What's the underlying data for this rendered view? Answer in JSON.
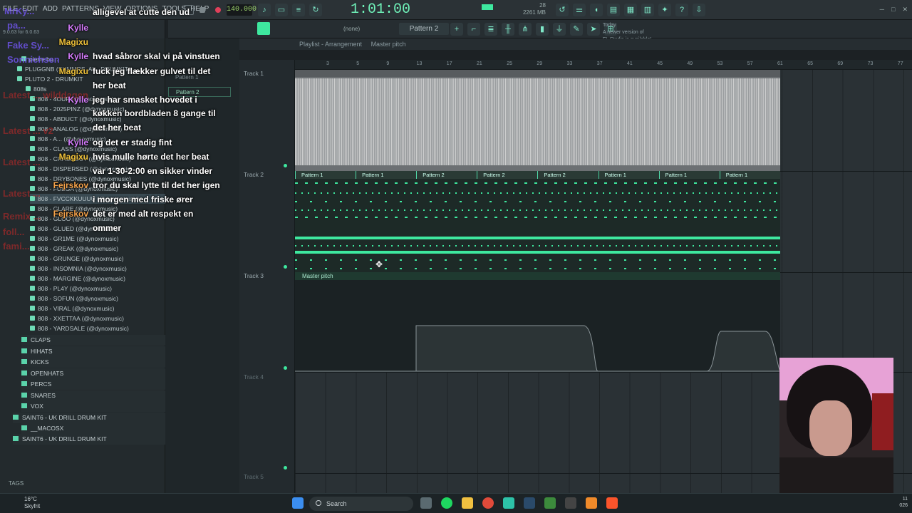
{
  "menu": [
    "FILE",
    "EDIT",
    "ADD",
    "PATTERNS",
    "VIEW",
    "OPTIONS",
    "TOOLS",
    "HELP"
  ],
  "transport": {
    "tempo": "140.000",
    "time": "1:01:00",
    "cpu_mem": "2261 MB",
    "cpu_val": "28",
    "cpu_zero": "0"
  },
  "toolbar2": {
    "pattern": "Pattern 2",
    "none": "(none)",
    "news_line1": "Today",
    "news_line2": "A newer version of",
    "news_line3": "FL Studio is available!"
  },
  "browser": {
    "version": "9.0.63 for 6.0.63",
    "folders_top": [
      "pierre bo...",
      "PLUGGNB (SUMMRS, AI... DRUMKIT",
      "PLUTO 2 - DRUMKIT",
      "808s"
    ],
    "items": [
      "808 - 4OUR (@dynoxmusic)",
      "808 - 2025PINZ (@dynoxmusic)",
      "808 - ABDUCT (@dynoxmusic)",
      "808 - ANALOG (@dynoxmusic)",
      "808 - A... (@dynoxmusic)",
      "808 - CLASS (@dynoxmusic)",
      "808 - CRASHOUT (@dynoxmusic)",
      "808 - DISPERSED (@dynoxmusic)",
      "808 - DRYBONES (@dynoxmusic)",
      "808 - FUEGA (@dynoxmusic)",
      "808 - FVCCKKUUUU (@dynoxmusic)",
      "808 - GLARE (@dynoxmusic)",
      "808 - GLOO (@dynoxmusic)",
      "808 - GLUED (@dynoxmusic)",
      "808 - GR1ME (@dynoxmusic)",
      "808 - GREAK (@dynoxmusic)",
      "808 - GRUNGE (@dynoxmusic)",
      "808 - INSOMNIA (@dynoxmusic)",
      "808 - MARGINE (@dynoxmusic)",
      "808 - PL4Y (@dynoxmusic)",
      "808 - SOFUN (@dynoxmusic)",
      "808 - VIRAL (@dynoxmusic)",
      "808 - XXETTAA (@dynoxmusic)",
      "808 - YARDSALE (@dynoxmusic)"
    ],
    "subfolders": [
      "CLAPS",
      "HIHATS",
      "KICKS",
      "OPENHATS",
      "PERCS",
      "SNARES",
      "VOX"
    ],
    "kit_folders": [
      "SAINT6 - UK DRILL DRUM KIT",
      "__MACOSX",
      "SAINT6 - UK DRILL DRUM KIT"
    ],
    "tags_label": "TAGS"
  },
  "patterns": [
    "Pattern 1",
    "Pattern 2"
  ],
  "playlist": {
    "title": "Playlist - Arrangement",
    "subtitle": "Master pitch",
    "tracks": [
      "Track 1",
      "Track 2",
      "Track 3",
      "Track 4",
      "Track 5"
    ],
    "ruler": [
      "3",
      "5",
      "9",
      "13",
      "17",
      "21",
      "25",
      "29",
      "33",
      "37",
      "41",
      "45",
      "49",
      "53",
      "57",
      "61",
      "65",
      "69",
      "73",
      "77"
    ],
    "pattern_clips": [
      "Pattern 1",
      "Pattern 1",
      "Pattern 2",
      "Pattern 2",
      "Pattern 2",
      "Pattern 1",
      "Pattern 1",
      "Pattern 1"
    ],
    "automation_label": "Master pitch"
  },
  "chat": [
    {
      "user": "",
      "text": "alligevel at cutte den ud"
    },
    {
      "user": "Kylle",
      "text": ""
    },
    {
      "user": "Magixu",
      "text": ""
    },
    {
      "user": "Kylle",
      "text": "hvad såbror skal vi på vinstuen"
    },
    {
      "user": "Magixu",
      "text": "fuck jeg flækker gulvet til det"
    },
    {
      "user": "",
      "text": "her beat"
    },
    {
      "user": "Kylle",
      "text": "jeg har smasket hovedet i"
    },
    {
      "user": "",
      "text": "køkken bordbladen 8 gange til"
    },
    {
      "user": "",
      "text": "det her beat"
    },
    {
      "user": "Kylle",
      "text": "og det er stadig fint"
    },
    {
      "user": "Magixu",
      "text": "hvis mulle hørte det her beat"
    },
    {
      "user": "",
      "text": "var 1-30-2:00 en sikker vinder"
    },
    {
      "user": "Fejrskov",
      "text": "tror du skal lytte til det her igen"
    },
    {
      "user": "",
      "text": "i morgen med friske ører"
    },
    {
      "user": "Fejrskov",
      "text": "det er med alt respekt en"
    },
    {
      "user": "",
      "text": "ommer"
    }
  ],
  "taskbar": {
    "temp": "16°C",
    "weather": "Skyfrit",
    "search": "Search",
    "time": "11",
    "date": "026"
  },
  "colors": {
    "accent": "#3ee89f",
    "bg": "#1c2124"
  }
}
